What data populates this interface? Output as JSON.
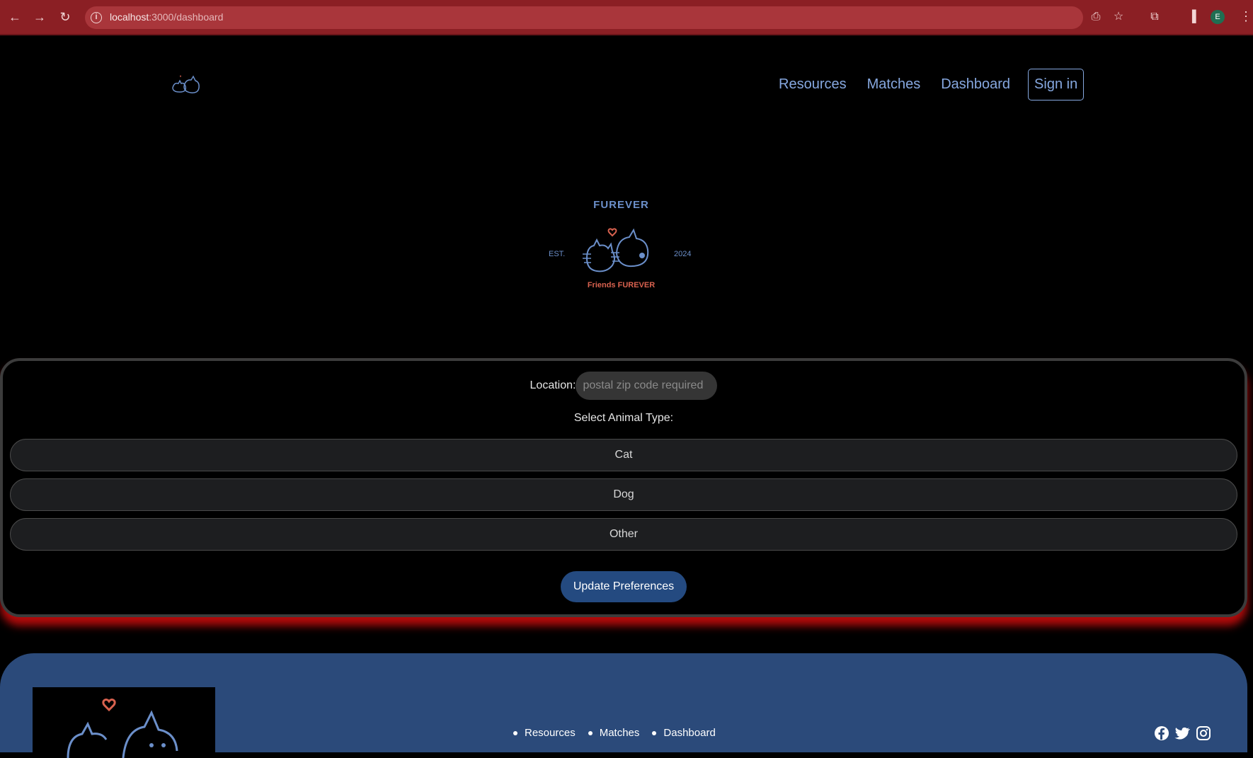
{
  "browser": {
    "url_host": "localhost",
    "url_path": ":3000/dashboard",
    "profile_initial": "E"
  },
  "header": {
    "nav": [
      "Resources",
      "Matches",
      "Dashboard"
    ],
    "signin_label": "Sign in"
  },
  "hero": {
    "title": "FUREVER",
    "est": "EST.",
    "year": "2024",
    "tagline": "Friends FUREVER"
  },
  "preferences": {
    "location_label": "Location:",
    "zip_placeholder": "postal zip code required",
    "animal_type_label": "Select Animal Type:",
    "options": [
      "Cat",
      "Dog",
      "Other"
    ],
    "update_label": "Update Preferences"
  },
  "footer": {
    "links": [
      "Resources",
      "Matches",
      "Dashboard"
    ]
  },
  "colors": {
    "chrome": "#8b1f24",
    "accent": "#86a8e0",
    "footer": "#2b4a7a",
    "button": "#244a80",
    "heart": "#d9624f"
  }
}
